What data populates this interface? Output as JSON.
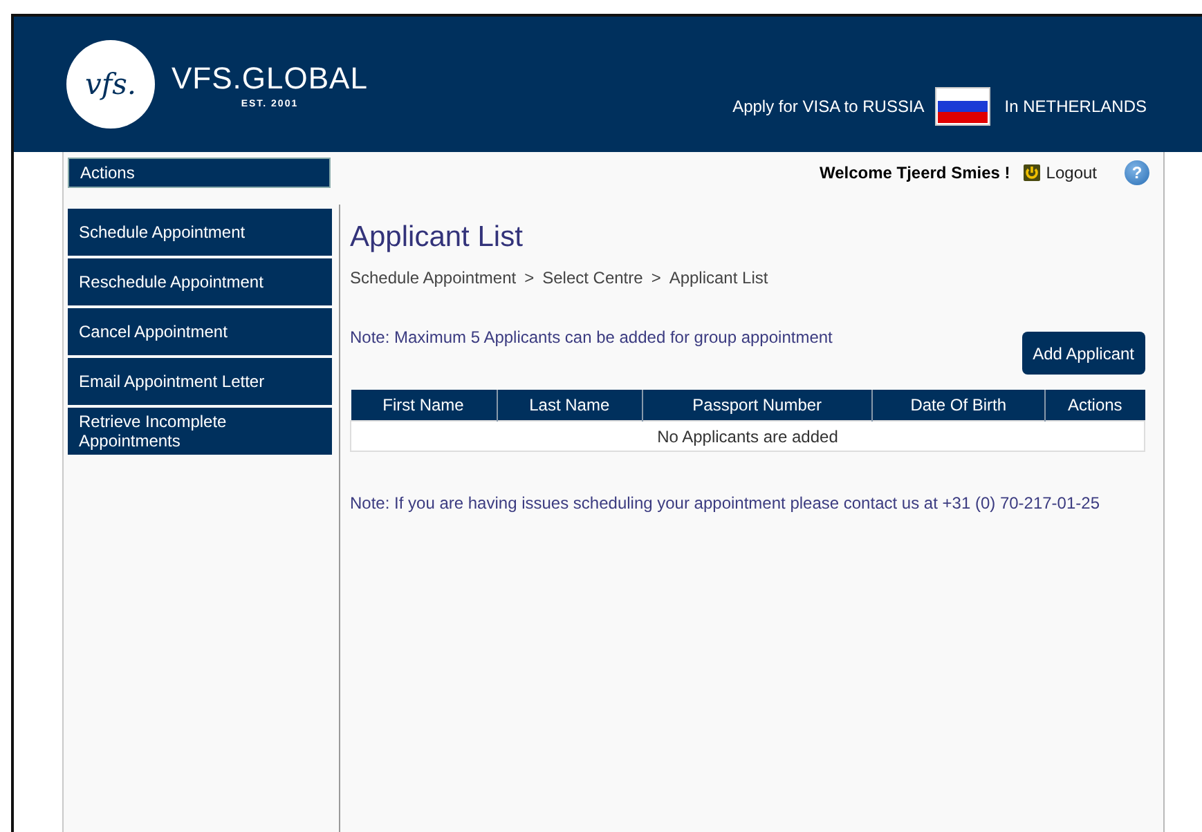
{
  "header": {
    "logo_mark": "vfs.",
    "logo_name": "VFS.GLOBAL",
    "logo_tagline": "EST. 2001",
    "apply_text": "Apply for VISA to RUSSIA",
    "location_text": "In NETHERLANDS"
  },
  "sidebar": {
    "title": "Actions",
    "items": [
      {
        "label": "Schedule Appointment"
      },
      {
        "label": "Reschedule Appointment"
      },
      {
        "label": "Cancel Appointment"
      },
      {
        "label": "Email Appointment Letter"
      },
      {
        "label": "Retrieve Incomplete Appointments"
      }
    ]
  },
  "user_bar": {
    "welcome": "Welcome Tjeerd Smies !",
    "logout": "Logout",
    "help": "?"
  },
  "page": {
    "title": "Applicant List",
    "breadcrumb": [
      "Schedule Appointment",
      "Select Centre",
      "Applicant List"
    ],
    "breadcrumb_separator": ">",
    "note": "Note: Maximum 5 Applicants can be added for group appointment",
    "add_button": "Add Applicant",
    "table": {
      "columns": [
        "First Name",
        "Last Name",
        "Passport Number",
        "Date Of Birth",
        "Actions"
      ],
      "empty_text": "No Applicants are added"
    },
    "contact_note": "Note: If you are having issues scheduling your appointment please contact us at +31 (0) 70-217-01-25"
  }
}
